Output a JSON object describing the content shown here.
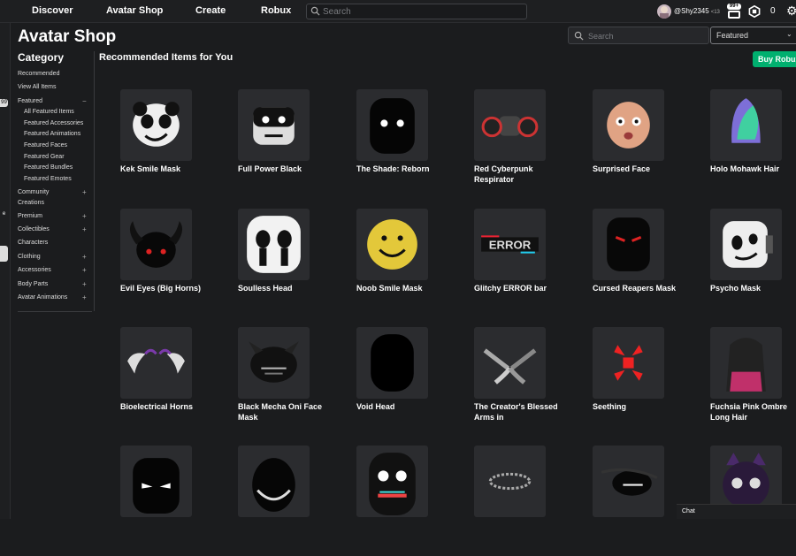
{
  "topbar": {
    "nav": [
      "Discover",
      "Avatar Shop",
      "Create",
      "Robux"
    ],
    "search_placeholder": "Search",
    "username": "@Shy2345",
    "age_tag": "<13",
    "notif_badge": "99+",
    "robux_count": "0"
  },
  "rail": {
    "tab1": "99",
    "tab2": "e"
  },
  "page_title": "Avatar Shop",
  "category": {
    "title": "Category",
    "items": [
      {
        "label": "Recommended",
        "sub": false,
        "pm": ""
      },
      {
        "label": "View All Items",
        "sub": false,
        "pm": ""
      },
      {
        "label": "Featured",
        "sub": false,
        "pm": "−"
      },
      {
        "label": "All Featured Items",
        "sub": true,
        "pm": ""
      },
      {
        "label": "Featured Accessories",
        "sub": true,
        "pm": ""
      },
      {
        "label": "Featured Animations",
        "sub": true,
        "pm": ""
      },
      {
        "label": "Featured Faces",
        "sub": true,
        "pm": ""
      },
      {
        "label": "Featured Gear",
        "sub": true,
        "pm": ""
      },
      {
        "label": "Featured Bundles",
        "sub": true,
        "pm": ""
      },
      {
        "label": "Featured Emotes",
        "sub": true,
        "pm": ""
      },
      {
        "label": "Community",
        "sub": false,
        "pm": "+"
      },
      {
        "label": "Creations",
        "sub": false,
        "pm": ""
      },
      {
        "label": "Premium",
        "sub": false,
        "pm": "+"
      },
      {
        "label": "Collectibles",
        "sub": false,
        "pm": "+"
      },
      {
        "label": "Characters",
        "sub": false,
        "pm": ""
      },
      {
        "label": "Clothing",
        "sub": false,
        "pm": "+"
      },
      {
        "label": "Accessories",
        "sub": false,
        "pm": "+"
      },
      {
        "label": "Body Parts",
        "sub": false,
        "pm": "+"
      },
      {
        "label": "Avatar Animations",
        "sub": false,
        "pm": "+"
      }
    ]
  },
  "section_title": "Recommended Items for You",
  "shop_search_placeholder": "Search",
  "sort_selected": "Featured",
  "buy_robux_label": "Buy Robux",
  "items": [
    {
      "name": "Kek Smile Mask",
      "icon": "panda-smile-mask-icon"
    },
    {
      "name": "Full Power Black",
      "icon": "black-white-face-icon"
    },
    {
      "name": "The Shade: Reborn",
      "icon": "shade-head-icon"
    },
    {
      "name": "Red Cyberpunk Respirator",
      "icon": "respirator-icon"
    },
    {
      "name": "Surprised Face",
      "icon": "surprised-face-icon"
    },
    {
      "name": "Holo Mohawk Hair",
      "icon": "mohawk-icon"
    },
    {
      "name": "Evil Eyes (Big Horns)",
      "icon": "horned-head-icon"
    },
    {
      "name": "Soulless Head",
      "icon": "soulless-head-icon"
    },
    {
      "name": "Noob Smile Mask",
      "icon": "smile-mask-icon"
    },
    {
      "name": "Glitchy ERROR bar",
      "icon": "error-bar-icon"
    },
    {
      "name": "Cursed Reapers Mask",
      "icon": "reaper-mask-icon"
    },
    {
      "name": "Psycho Mask",
      "icon": "psycho-mask-icon"
    },
    {
      "name": "Bioelectrical Horns",
      "icon": "horns-icon"
    },
    {
      "name": "Black Mecha Oni Face Mask",
      "icon": "oni-mask-icon"
    },
    {
      "name": "Void Head",
      "icon": "void-head-icon"
    },
    {
      "name": "The Creator's Blessed Arms in",
      "icon": "arms-icon"
    },
    {
      "name": "Seething",
      "icon": "anger-mark-icon"
    },
    {
      "name": "Fuchsia Pink Ombre Long Hair",
      "icon": "long-hair-icon"
    },
    {
      "name": "",
      "icon": "angry-head-icon"
    },
    {
      "name": "",
      "icon": "grin-head-icon"
    },
    {
      "name": "",
      "icon": "glitch-mask-icon"
    },
    {
      "name": "",
      "icon": "halo-icon"
    },
    {
      "name": "",
      "icon": "eyepatch-icon"
    },
    {
      "name": "",
      "icon": "cat-mask-icon"
    }
  ],
  "chat_label": "Chat",
  "colors": {
    "background": "#1b1c1e",
    "card": "#2b2c2f",
    "buy_button": "#00b06f"
  }
}
